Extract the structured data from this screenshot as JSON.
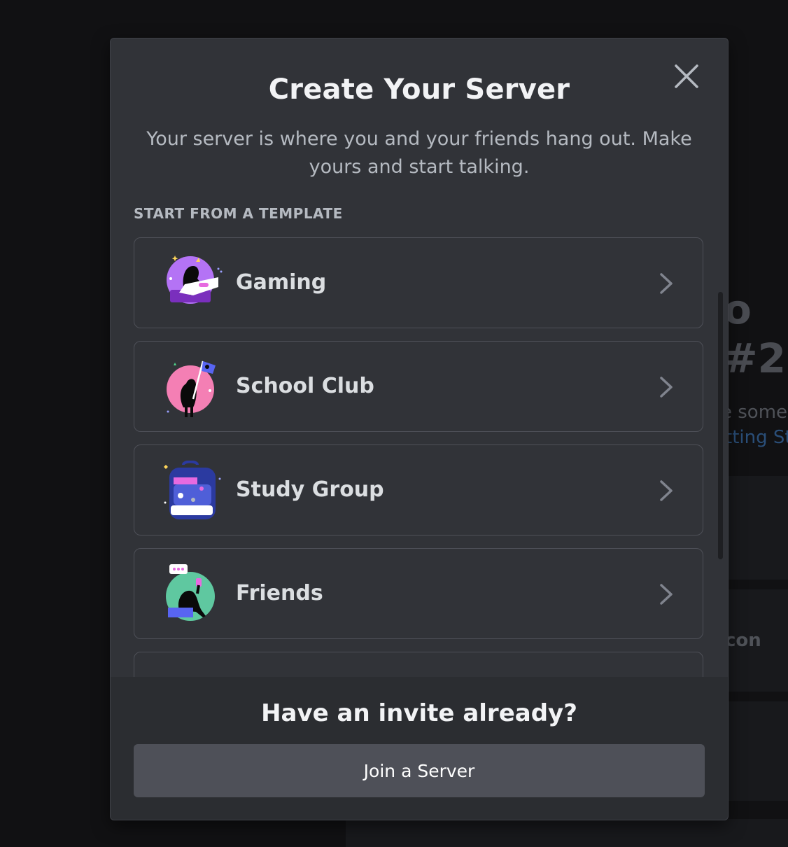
{
  "background": {
    "fragment_big_1": "o",
    "fragment_big_2": "#2",
    "fragment_text_1": "e some s",
    "fragment_link": "tting St",
    "fragment_text_2": "con"
  },
  "modal": {
    "title": "Create Your Server",
    "subtitle": "Your server is where you and your friends hang out. Make yours and start talking.",
    "section_label": "START FROM A TEMPLATE",
    "templates": [
      {
        "label": "Gaming",
        "icon": "gaming-icon",
        "color": "#b473f5"
      },
      {
        "label": "School Club",
        "icon": "school-club-icon",
        "color": "#f47fb4"
      },
      {
        "label": "Study Group",
        "icon": "study-group-icon",
        "color": "#4f5fd8"
      },
      {
        "label": "Friends",
        "icon": "friends-icon",
        "color": "#5fc8a0"
      }
    ],
    "footer": {
      "title": "Have an invite already?",
      "join_label": "Join a Server"
    }
  },
  "colors": {
    "modal_bg": "#313338",
    "footer_bg": "#2b2d31",
    "button_bg": "#4e5058",
    "title": "#f2f3f5",
    "subtitle": "#b5bac1"
  }
}
